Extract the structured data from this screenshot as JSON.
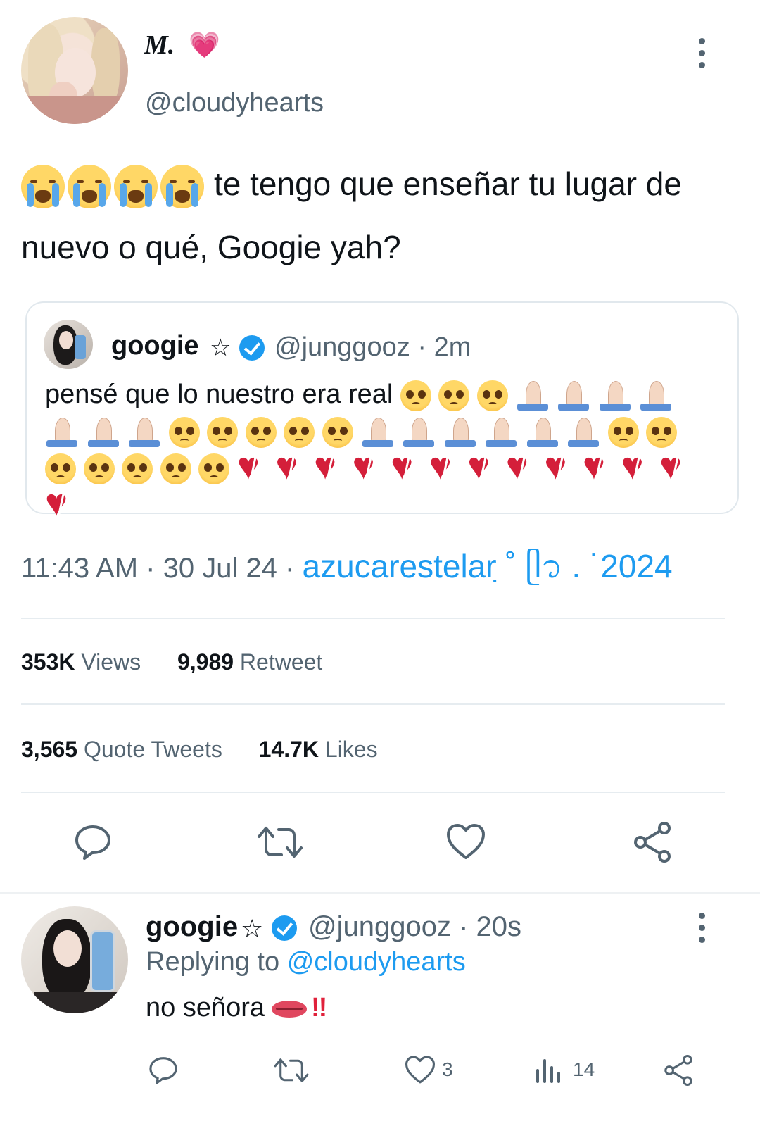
{
  "tweet": {
    "author": {
      "name": "M.",
      "heart_emoji": "💗",
      "handle": "@cloudyhearts"
    },
    "text": "te tengo que enseñar tu lugar de nuevo o qué, Googie yah?",
    "leading_emoji": "crying-face-emoji",
    "quoted": {
      "name": "googie",
      "star": "☆",
      "handle_time": "@junggooz · 2m",
      "text": "pensé que lo nuestro era real"
    },
    "time": "11:43 AM · 30 Jul 24 · ",
    "source": "azucarestelar ̣˚ ᥫ᭡ . ˙2024",
    "stats": {
      "views_count": "353K",
      "views_label": "Views",
      "retweets_count": "9,989",
      "retweets_label": "Retweet",
      "quotes_count": "3,565",
      "quotes_label": "Quote Tweets",
      "likes_count": "14.7K",
      "likes_label": "Likes"
    }
  },
  "reply": {
    "name": "googie",
    "star": "☆",
    "handle_time": "@junggooz · 20s",
    "replying_prefix": "Replying to",
    "replying_handle": "@cloudyhearts",
    "text": "no señora",
    "bangs": "!!",
    "likes": "3",
    "views": "14"
  },
  "colors": {
    "accent": "#1d9bf0",
    "muted": "#536471",
    "text": "#0f1419",
    "divider": "#e6ecf0"
  },
  "icons": [
    "more-icon",
    "verified-icon",
    "reply-icon",
    "retweet-icon",
    "like-icon",
    "share-icon",
    "views-icon"
  ]
}
